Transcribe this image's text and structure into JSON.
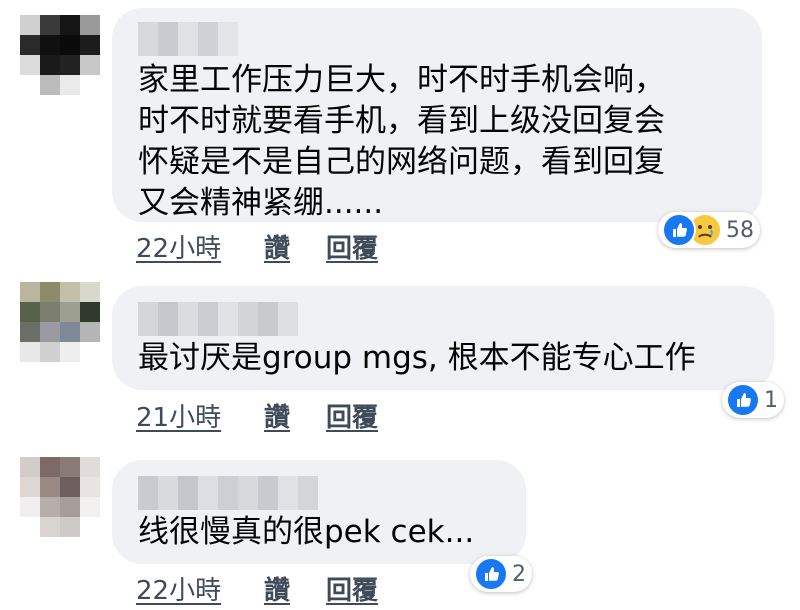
{
  "comments": [
    {
      "text": "家里工作压力巨大，时不时手机会响，\n时不时就要看手机，看到上级没回复会\n怀疑是不是自己的网络问题，看到回复\n又会精神紧绷......",
      "time": "22小時",
      "like": "讚",
      "reply": "回覆",
      "reactions": [
        "like-icon",
        "sad-icon"
      ],
      "count": "58"
    },
    {
      "text": "最讨厌是group mgs, 根本不能专心工作",
      "time": "21小時",
      "like": "讚",
      "reply": "回覆",
      "reactions": [
        "like-icon"
      ],
      "count": "1"
    },
    {
      "text": "线很慢真的很pek cek...",
      "time": "22小時",
      "like": "讚",
      "reply": "回覆",
      "reactions": [
        "like-icon"
      ],
      "count": "2"
    }
  ],
  "colors": {
    "bubble": "#eff1f4",
    "meta_text": "#3f4a5a",
    "like_blue": "#1877f2",
    "sad_yellow": "#f7c93e"
  }
}
